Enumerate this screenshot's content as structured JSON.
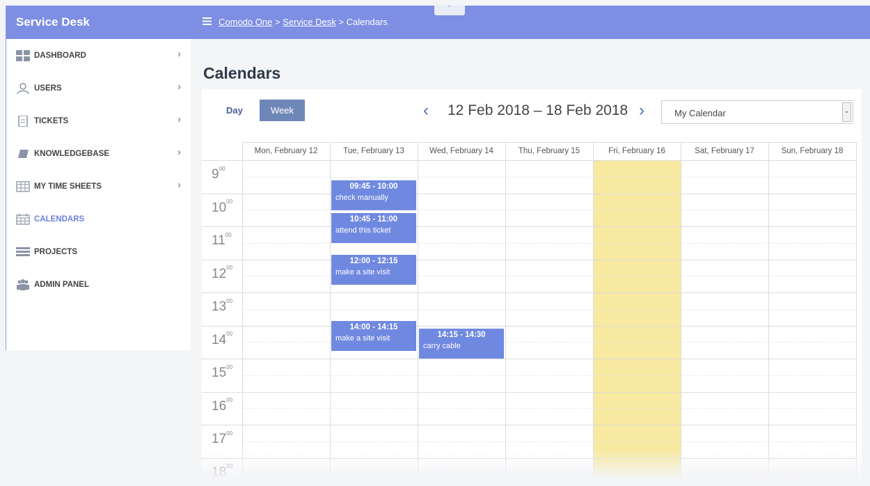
{
  "sidebar": {
    "title": "Service Desk",
    "items": [
      {
        "label": "DASHBOARD",
        "icon": "dashboard-icon"
      },
      {
        "label": "USERS",
        "icon": "user-icon"
      },
      {
        "label": "TICKETS",
        "icon": "ticket-icon"
      },
      {
        "label": "KNOWLEDGEBASE",
        "icon": "book-icon"
      },
      {
        "label": "MY TIME SHEETS",
        "icon": "timesheet-icon"
      },
      {
        "label": "CALENDARS",
        "icon": "calendar-icon",
        "active": true
      },
      {
        "label": "PROJECTS",
        "icon": "projects-icon"
      },
      {
        "label": "ADMIN PANEL",
        "icon": "admin-icon"
      }
    ]
  },
  "breadcrumb": {
    "items": [
      "Comodo One",
      "Service Desk",
      "Calendars"
    ],
    "separator": ">"
  },
  "page": {
    "title": "Calendars"
  },
  "toolbar": {
    "day_label": "Day",
    "week_label": "Week",
    "date_range": "12 Feb 2018 – 18 Feb 2018",
    "calendar_select": "My Calendar"
  },
  "calendar": {
    "days": [
      "Mon, February 12",
      "Tue, February 13",
      "Wed, February 14",
      "Thu, February 15",
      "Fri, February 16",
      "Sat, February 17",
      "Sun, February 18"
    ],
    "hours": [
      "9",
      "10",
      "11",
      "12",
      "13",
      "14",
      "15",
      "16",
      "17",
      "18"
    ],
    "minutes_label": "00",
    "highlighted_day": "Fri, February 16",
    "events": [
      {
        "time": "09:45 - 10:00",
        "title": "check manually",
        "day": "Tue, February 13"
      },
      {
        "time": "10:45 - 11:00",
        "title": "attend this ticket",
        "day": "Tue, February 13"
      },
      {
        "time": "12:00 - 12:15",
        "title": "make a site visit",
        "day": "Tue, February 13"
      },
      {
        "time": "14:00 - 14:15",
        "title": "make a site visit",
        "day": "Tue, February 13"
      },
      {
        "time": "14:15 - 14:30",
        "title": "carry cable",
        "day": "Wed, February 14"
      }
    ]
  },
  "colors": {
    "header_bg": "#7d8ee3",
    "event_bg": "#7089e0",
    "today_highlight": "#f8e9a0",
    "active_nav": "#6d80dd"
  }
}
